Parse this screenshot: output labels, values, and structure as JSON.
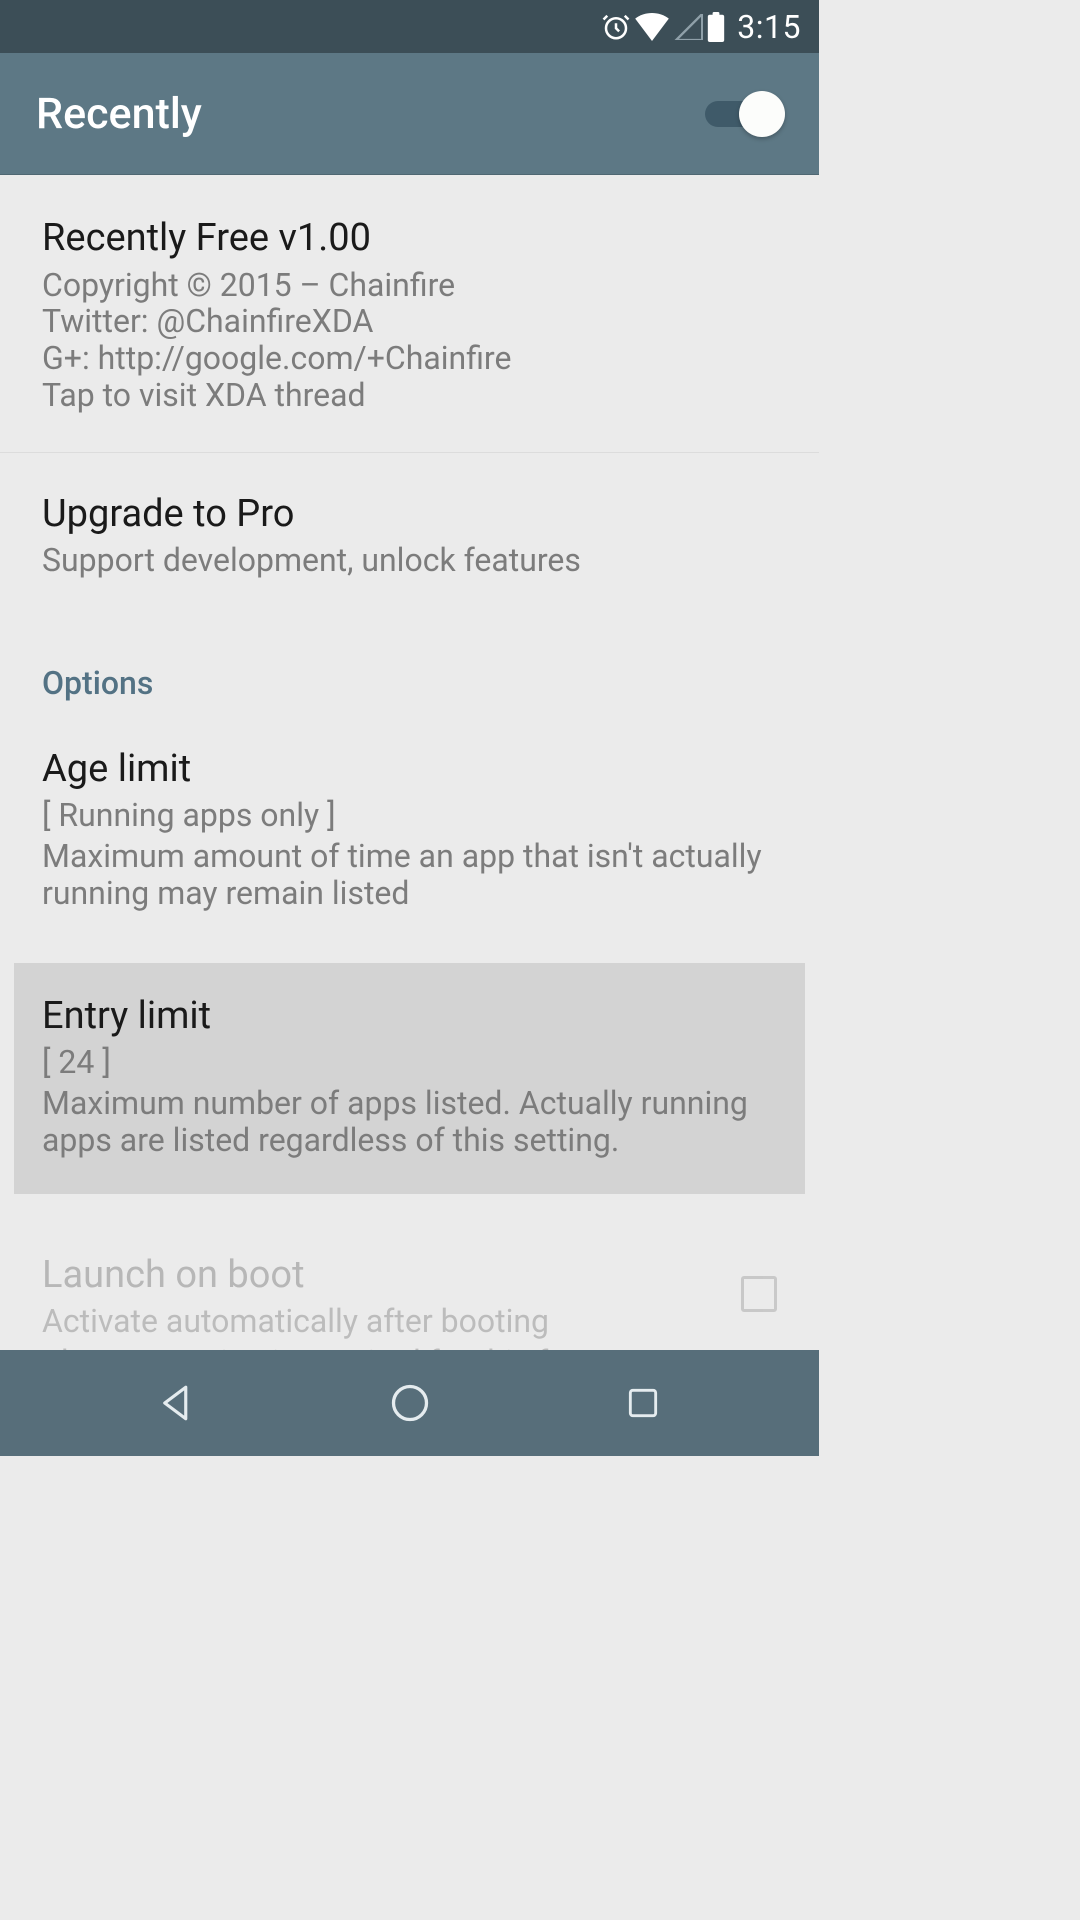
{
  "status": {
    "time": "3:15"
  },
  "appbar": {
    "title": "Recently",
    "toggle_on": true
  },
  "info": {
    "title": "Recently Free v1.00",
    "body": "Copyright © 2015 – Chainfire\nTwitter: @ChainfireXDA\nG+: http://google.com/+Chainfire\nTap to visit XDA thread"
  },
  "upgrade": {
    "title": "Upgrade to Pro",
    "sub": "Support development, unlock features"
  },
  "section_options": "Options",
  "age": {
    "title": "Age limit",
    "value": "[ Running apps only ]",
    "desc": "Maximum amount of time an app that isn't actually running may remain listed"
  },
  "entry": {
    "title": "Entry limit",
    "value": "[ 24 ]",
    "desc": "Maximum number of apps listed. Actually running apps are listed regardless of this setting."
  },
  "launch": {
    "title": "Launch on boot",
    "sub1": "Activate automatically after booting",
    "sub2": "The Pro version is required for this feature"
  }
}
